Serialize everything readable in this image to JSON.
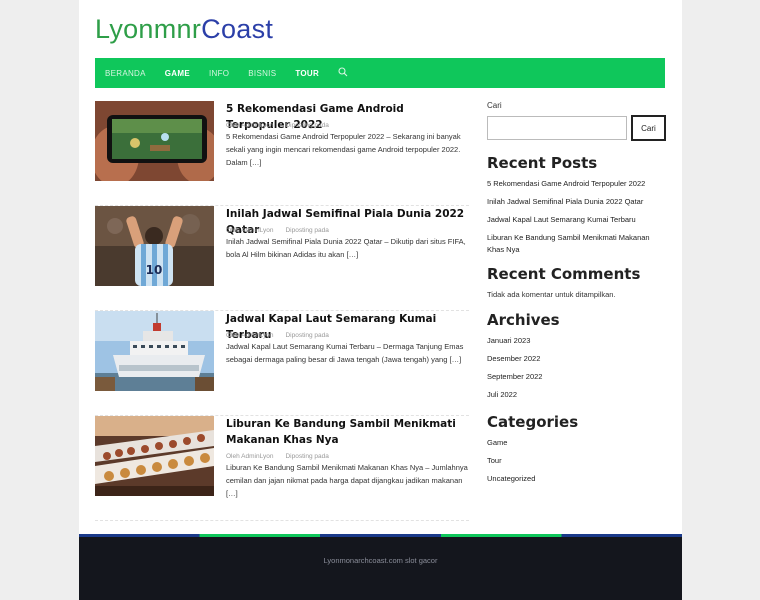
{
  "site": {
    "logo_part1": "Lyonmnr",
    "logo_part2": "Coast"
  },
  "nav": {
    "items": [
      "BERANDA",
      "GAME",
      "INFO",
      "BISNIS",
      "TOUR"
    ]
  },
  "posts": [
    {
      "title": "5 Rekomendasi Game Android Terpopuler 2022",
      "author": "Oleh AdminLyon",
      "posted": "Diposting pada",
      "excerpt": "5 Rekomendasi Game Android Terpopuler 2022 – Sekarang ini banyak sekali yang ingin mencari rekomendasi game Android terpopuler 2022. Dalam […]"
    },
    {
      "title": "Inilah Jadwal Semifinal Piala Dunia 2022 Qatar",
      "author": "Oleh AdminLyon",
      "posted": "Diposting pada",
      "excerpt": "Inilah Jadwal Semifinal Piala Dunia 2022 Qatar – Dikutip dari situs FIFA, bola Al Hilm bikinan Adidas itu akan […]"
    },
    {
      "title": "Jadwal Kapal Laut Semarang Kumai Terbaru",
      "author": "Oleh AdminLyon",
      "posted": "Diposting pada",
      "excerpt": "Jadwal Kapal Laut Semarang Kumai Terbaru – Dermaga Tanjung Emas sebagai dermaga paling besar di Jawa tengah (Jawa tengah) yang […]"
    },
    {
      "title": "Liburan Ke Bandung Sambil Menikmati Makanan Khas Nya",
      "author": "Oleh AdminLyon",
      "posted": "Diposting pada",
      "excerpt": "Liburan Ke Bandung Sambil Menikmati Makanan Khas Nya – Jumlahnya cemilan dan jajan nikmat pada harga dapat dijangkau jadikan makanan […]"
    }
  ],
  "sidebar": {
    "search_label": "Cari",
    "search_button": "Cari",
    "recent_posts_title": "Recent Posts",
    "recent_posts": [
      "5 Rekomendasi Game Android Terpopuler 2022",
      "Inilah Jadwal Semifinal Piala Dunia 2022 Qatar",
      "Jadwal Kapal Laut Semarang Kumai Terbaru",
      "Liburan Ke Bandung Sambil Menikmati Makanan Khas Nya"
    ],
    "recent_comments_title": "Recent Comments",
    "no_comments": "Tidak ada komentar untuk ditampilkan.",
    "archives_title": "Archives",
    "archives": [
      "Januari 2023",
      "Desember 2022",
      "September 2022",
      "Juli 2022"
    ],
    "categories_title": "Categories",
    "categories": [
      "Game",
      "Tour",
      "Uncategorized"
    ]
  },
  "footer": {
    "text": "Lyonmonarchcoast.com slot gacor"
  },
  "colors": {
    "nav_bg": "#0fc75b",
    "logo_green": "#2e9e48",
    "logo_blue": "#2b3fa8",
    "footer_bg": "#14161d"
  }
}
